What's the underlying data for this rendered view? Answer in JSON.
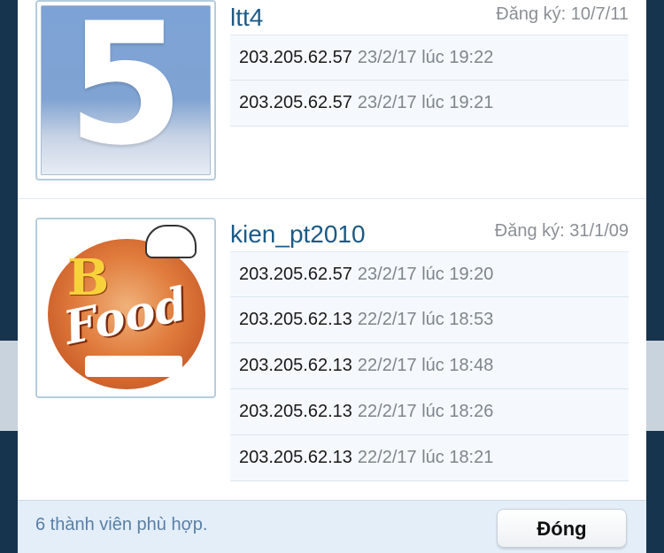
{
  "members": [
    {
      "username": "ltt4",
      "joined": "Đăng ký: 10/7/11",
      "avatar_icon": "number-5-avatar",
      "ips": [
        {
          "ip": "203.205.62.57",
          "time": "23/2/17 lúc 19:22"
        },
        {
          "ip": "203.205.62.57",
          "time": "23/2/17 lúc 19:21"
        }
      ]
    },
    {
      "username": "kien_pt2010",
      "joined": "Đăng ký: 31/1/09",
      "avatar_icon": "food-logo-avatar",
      "avatar_text": "Food",
      "ips": [
        {
          "ip": "203.205.62.57",
          "time": "23/2/17 lúc 19:20"
        },
        {
          "ip": "203.205.62.13",
          "time": "22/2/17 lúc 18:53"
        },
        {
          "ip": "203.205.62.13",
          "time": "22/2/17 lúc 18:48"
        },
        {
          "ip": "203.205.62.13",
          "time": "22/2/17 lúc 18:26"
        },
        {
          "ip": "203.205.62.13",
          "time": "22/2/17 lúc 18:21"
        }
      ]
    }
  ],
  "footer": {
    "count_text": "6 thành viên phù hợp.",
    "close_label": "Đóng"
  },
  "colors": {
    "username": "#1c5a86",
    "footer_bg": "#e3eef9",
    "backdrop": "#17344f"
  }
}
